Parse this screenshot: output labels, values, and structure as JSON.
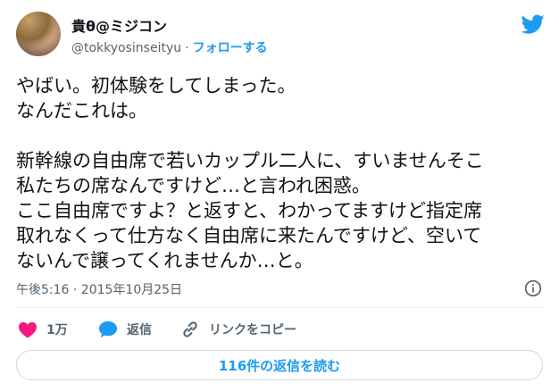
{
  "user": {
    "display_name": "貴θ@ミジコン",
    "handle": "@tokkyosinseityu",
    "separator": "·",
    "follow_label": "フォローする"
  },
  "tweet": {
    "lines": [
      "やばい。初体験をしてしまった。",
      "なんだこれは。",
      "",
      "新幹線の自由席で若いカップル二人に、すいませんそこ",
      "私たちの席なんですけど…と言われ困惑。",
      "ここ自由席ですよ？と返すと、わかってますけど指定席",
      "取れなくって仕方なく自由席に来たんですけど、空いて",
      "ないんで譲ってくれませんか…と。"
    ],
    "timestamp": "午後5:16 · 2015年10月25日"
  },
  "actions": {
    "like_count": "1万",
    "reply_label": "返信",
    "copy_link_label": "リンクをコピー"
  },
  "replies_button_label": "116件の返信を読む",
  "colors": {
    "twitter_blue": "#1d9bf0",
    "like_pink": "#f91880",
    "text_primary": "#0f1419",
    "text_secondary": "#536471"
  }
}
